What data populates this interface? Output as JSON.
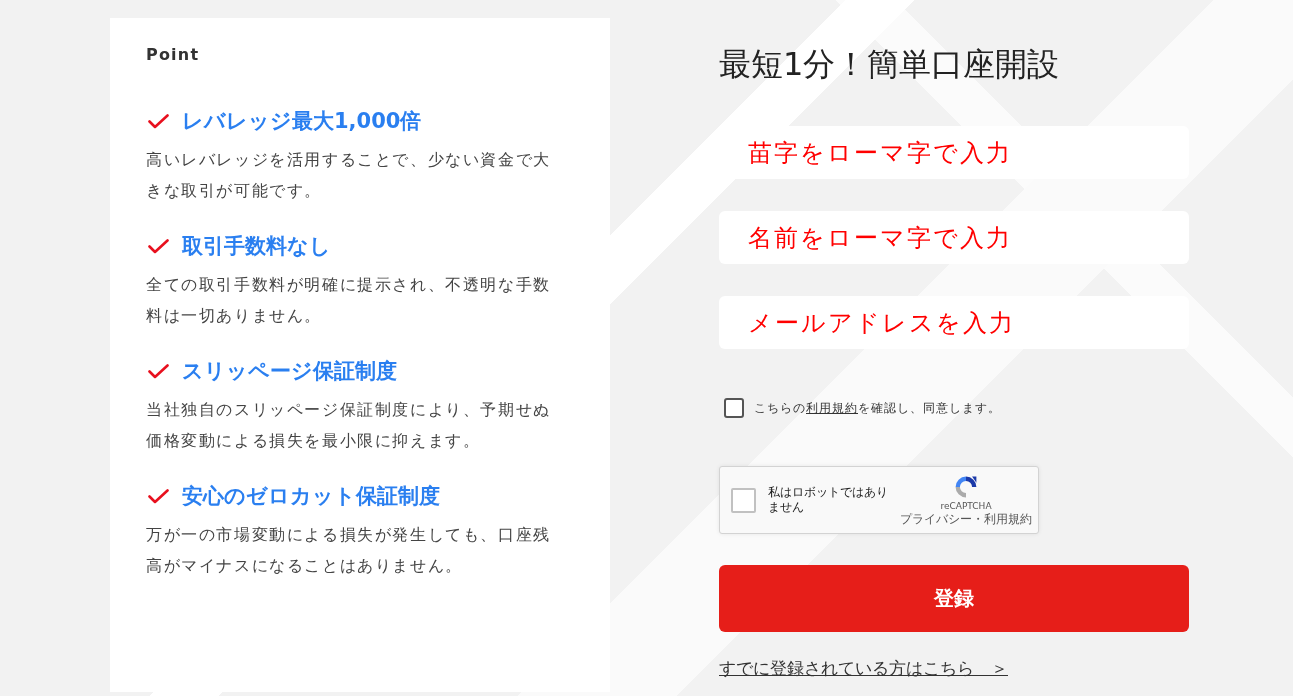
{
  "points_panel": {
    "title": "Point",
    "items": [
      {
        "heading": "レバレッジ最大1,000倍",
        "description": "高いレバレッジを活用することで、少ない資金で大きな取引が可能です。"
      },
      {
        "heading": "取引手数料なし",
        "description": "全ての取引手数料が明確に提示され、不透明な手数料は一切ありません。"
      },
      {
        "heading": "スリッページ保証制度",
        "description": "当社独自のスリッページ保証制度により、予期せぬ価格変動による損失を最小限に抑えます。"
      },
      {
        "heading": "安心のゼロカット保証制度",
        "description": "万が一の市場変動による損失が発生しても、口座残高がマイナスになることはありません。"
      }
    ]
  },
  "signup_form": {
    "title": "最短1分！簡単口座開設",
    "fields": [
      {
        "placeholder": "苗字をローマ字で入力"
      },
      {
        "placeholder": "名前をローマ字で入力"
      },
      {
        "placeholder": "メールアドレスを入力"
      }
    ],
    "terms_agreement": {
      "checked": false,
      "text_before": "こちらの",
      "link": "利用規約",
      "text_after": "を確認し、同意します。"
    },
    "recaptcha": {
      "checked": false,
      "label": "私はロボットではありません",
      "brand": "reCAPTCHA",
      "footer": "プライバシー・利用規約"
    },
    "submit_button": "登録",
    "login_link": "すでに登録されている方はこちら　＞"
  }
}
